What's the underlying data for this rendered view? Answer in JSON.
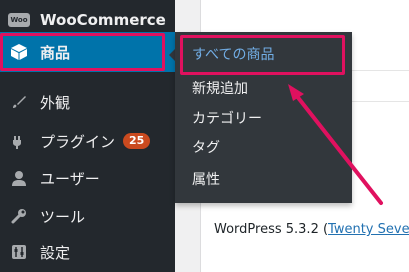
{
  "sidebar": {
    "items": [
      {
        "label": "WooCommerce",
        "icon": "woo-icon"
      },
      {
        "label": "商品",
        "icon": "product-box-icon",
        "active": true
      },
      {
        "label": "外観",
        "icon": "brush-icon"
      },
      {
        "label": "プラグイン",
        "icon": "plugin-icon",
        "badge": "25"
      },
      {
        "label": "ユーザー",
        "icon": "user-icon"
      },
      {
        "label": "ツール",
        "icon": "wrench-icon"
      },
      {
        "label": "設定",
        "icon": "settings-icon"
      }
    ],
    "woo_icon_text": "Woo"
  },
  "flyout": {
    "items": [
      {
        "label": "すべての商品"
      },
      {
        "label": "新規追加"
      },
      {
        "label": "カテゴリー"
      },
      {
        "label": "タグ"
      },
      {
        "label": "属性"
      }
    ]
  },
  "footer": {
    "version_text": "WordPress 5.3.2 (",
    "theme_link": "Twenty Seve"
  },
  "colors": {
    "sidebar_bg": "#23282d",
    "flyout_bg": "#32373c",
    "active_bg": "#0073aa",
    "highlight": "#e0115f",
    "current_link": "#72aee6",
    "badge": "#ca4a1f"
  }
}
